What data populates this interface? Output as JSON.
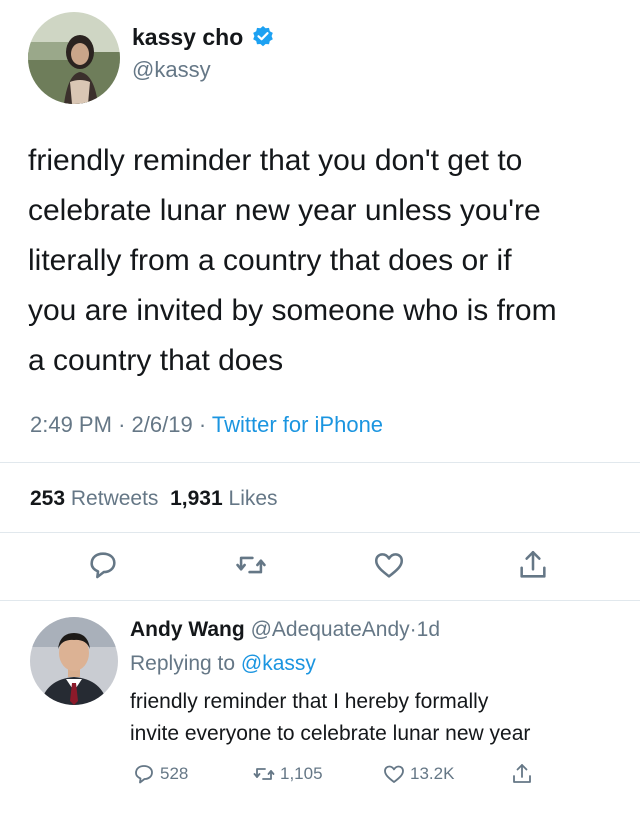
{
  "tweet": {
    "author_name": "kassy cho",
    "author_handle": "@kassy",
    "text_lines": [
      "friendly reminder that you don't get to",
      "celebrate lunar new year unless you're",
      "literally from a country that does or if",
      "you are invited by someone who is from",
      "a country that does"
    ],
    "time": "2:49 PM",
    "date": "2/6/19",
    "dot": "·",
    "source": "Twitter for iPhone",
    "retweets_count": "253",
    "retweets_label": "Retweets",
    "likes_count": "1,931",
    "likes_label": "Likes"
  },
  "actions": {
    "icons": [
      "reply-icon",
      "retweet-icon",
      "like-icon",
      "share-icon"
    ]
  },
  "reply": {
    "author_name": "Andy Wang",
    "author_handle": "@AdequateAndy",
    "dot": "·",
    "age": "1d",
    "replying_label": "Replying to",
    "replying_to": "@kassy",
    "text_lines": [
      "friendly reminder that I hereby formally",
      "invite everyone to celebrate lunar new year"
    ],
    "reply_count": "528",
    "retweet_count": "1,105",
    "like_count": "13.2K"
  },
  "colors": {
    "accent": "#1b95e0",
    "verified": "#1da1f2",
    "secondary_text": "#657786",
    "divider": "#e1e8ed"
  }
}
